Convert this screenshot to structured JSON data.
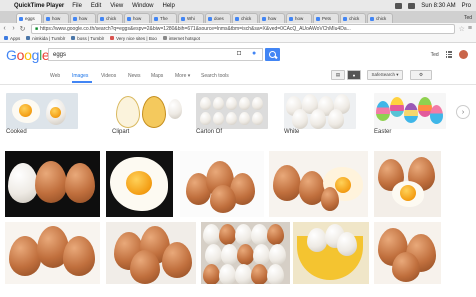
{
  "menubar": {
    "app_name": "QuickTime Player",
    "items": [
      "File",
      "Edit",
      "View",
      "Window",
      "Help"
    ],
    "clock": "Sun 8:30 AM",
    "user": "Pro"
  },
  "tabs": [
    {
      "label": "eggs"
    },
    {
      "label": "how"
    },
    {
      "label": "how"
    },
    {
      "label": "chick"
    },
    {
      "label": "how"
    },
    {
      "label": "The"
    },
    {
      "label": "Whi"
    },
    {
      "label": "does"
    },
    {
      "label": "chick"
    },
    {
      "label": "how"
    },
    {
      "label": "how"
    },
    {
      "label": "Pets"
    },
    {
      "label": "chick"
    },
    {
      "label": "chick"
    }
  ],
  "tab_user": "Ted",
  "address": {
    "url": "https://www.google.co.th/search?q=eggs&espv=2&biw=1280&bih=671&source=lnms&tbm=isch&sa=X&ved=0CAcQ_AUoAWoVChMIu4Da..."
  },
  "bookmarks": [
    {
      "label": "Apps"
    },
    {
      "label": "nimkida | Tumblr"
    },
    {
      "label": "boss | Tumblr"
    },
    {
      "label": "Very nice sites | Boo"
    },
    {
      "label": "internet hotspot"
    }
  ],
  "logo": {
    "g1": "G",
    "o1": "o",
    "o2": "o",
    "g2": "g",
    "l": "l",
    "e": "e"
  },
  "search": {
    "query": "eggs"
  },
  "header_right": {
    "user_name": "Ted"
  },
  "filters": {
    "tabs": [
      "Web",
      "Images",
      "Videos",
      "News",
      "Maps",
      "More ▾",
      "Search tools"
    ],
    "active": "Images",
    "safesearch": "SafeSearch ▾"
  },
  "suggestions": [
    {
      "label": "Cooked"
    },
    {
      "label": "Clipart"
    },
    {
      "label": "Carton Of"
    },
    {
      "label": "White"
    },
    {
      "label": "Easter"
    }
  ],
  "icons": {
    "apple": "",
    "back": "‹",
    "forward": "›",
    "reload": "↻",
    "lock": "🔒",
    "star": "☆",
    "menu": "≡",
    "camera": "📷",
    "mic": "🎤",
    "chevron": "›",
    "settings": "⚙",
    "filter": "▤"
  }
}
